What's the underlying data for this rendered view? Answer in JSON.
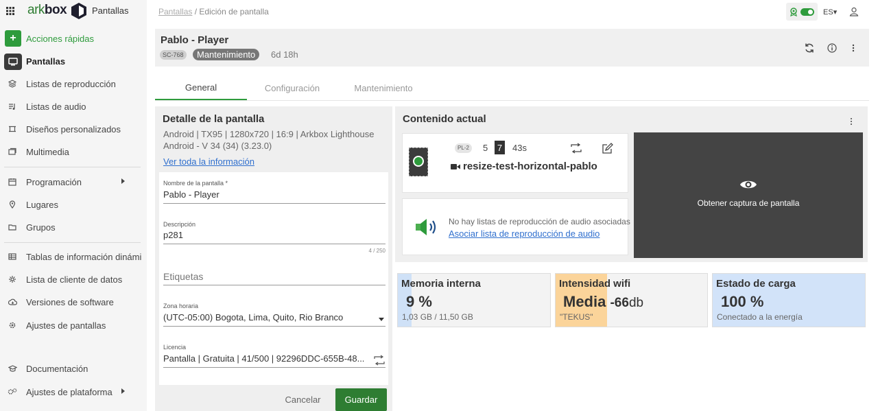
{
  "app": {
    "logo_ark": "ark",
    "logo_box": "box",
    "name": "Pantallas"
  },
  "sidebar": {
    "quick_actions": "Acciones rápidas",
    "items": [
      {
        "label": "Pantallas",
        "icon": "monitor-icon",
        "active": true
      },
      {
        "label": "Listas de reproducción",
        "icon": "playlist-icon"
      },
      {
        "label": "Listas de audio",
        "icon": "audio-list-icon"
      },
      {
        "label": "Diseños personalizados",
        "icon": "layout-icon"
      },
      {
        "label": "Multimedia",
        "icon": "media-icon"
      },
      {
        "label": "Programación",
        "icon": "calendar-icon",
        "submenu": true
      },
      {
        "label": "Lugares",
        "icon": "location-icon"
      },
      {
        "label": "Grupos",
        "icon": "folder-icon"
      },
      {
        "label": "Tablas de información dinámica",
        "icon": "table-icon"
      },
      {
        "label": "Lista de cliente de datos",
        "icon": "data-client-icon"
      },
      {
        "label": "Versiones de software",
        "icon": "cloud-icon"
      },
      {
        "label": "Ajustes de pantallas",
        "icon": "gear-icon"
      },
      {
        "label": "Documentación",
        "icon": "graduation-icon"
      },
      {
        "label": "Ajustes de plataforma",
        "icon": "gears-icon",
        "submenu": true
      }
    ]
  },
  "breadcrumb": {
    "parent": "Pantallas",
    "separator": " / ",
    "current": "Edición de pantalla"
  },
  "topbar": {
    "language": "ES"
  },
  "screen": {
    "title": "Pablo - Player",
    "code": "SC-768",
    "status": "Mantenimiento",
    "uptime": "6d 18h"
  },
  "tabs": [
    {
      "label": "General",
      "active": true
    },
    {
      "label": "Configuración"
    },
    {
      "label": "Mantenimiento"
    }
  ],
  "detail": {
    "title": "Detalle de la pantalla",
    "spec_line_1": "Android | TX95 | 1280x720 | 16:9 | Arkbox Lighthouse",
    "spec_line_2": "Android - V 34 (34) (3.23.0)",
    "more_link": "Ver toda la información",
    "name_label": "Nombre de la pantalla *",
    "name_value": "Pablo - Player",
    "description_label": "Descripción",
    "description_value": "p281",
    "description_counter": "4 / 250",
    "tags_placeholder": "Etiquetas",
    "timezone_label": "Zona horaria",
    "timezone_value": "(UTC-05:00) Bogota, Lima, Quito, Rio Branco",
    "license_label": "Licencia",
    "license_value": "Pantalla | Gratuita | 41/500 |   92296DDC-655B-48...",
    "cancel": "Cancelar",
    "save": "Guardar"
  },
  "content": {
    "title": "Contenido actual",
    "playlist_code": "PL-2",
    "count_a": "5",
    "count_b": "7",
    "duration": "43s",
    "media_name": "resize-test-horizontal-pablo",
    "no_audio": "No hay listas de reproducción de audio asociadas",
    "associate_audio": "Asociar lista de reproducción de audio",
    "capture": "Obtener captura de pantalla"
  },
  "stats": {
    "memory": {
      "title": "Memoria interna",
      "value": "9 %",
      "detail": "1,03 GB / 11,50 GB",
      "fill_percent": 9,
      "color": "#cfe1f7"
    },
    "wifi": {
      "title": "Intensidad wifi",
      "value": "Media",
      "signal": "-66",
      "unit": "db",
      "detail": "\"TEKUS\"",
      "fill_percent": 34,
      "color": "#fbd49a"
    },
    "battery": {
      "title": "Estado de carga",
      "value": "100 %",
      "detail": "Conectado a la energía",
      "fill_percent": 100,
      "color": "#d2e3f9"
    }
  },
  "colors": {
    "brand_green": "#2e7d32",
    "accent_green": "#2e9b3c",
    "link_blue": "#2f6fce"
  }
}
